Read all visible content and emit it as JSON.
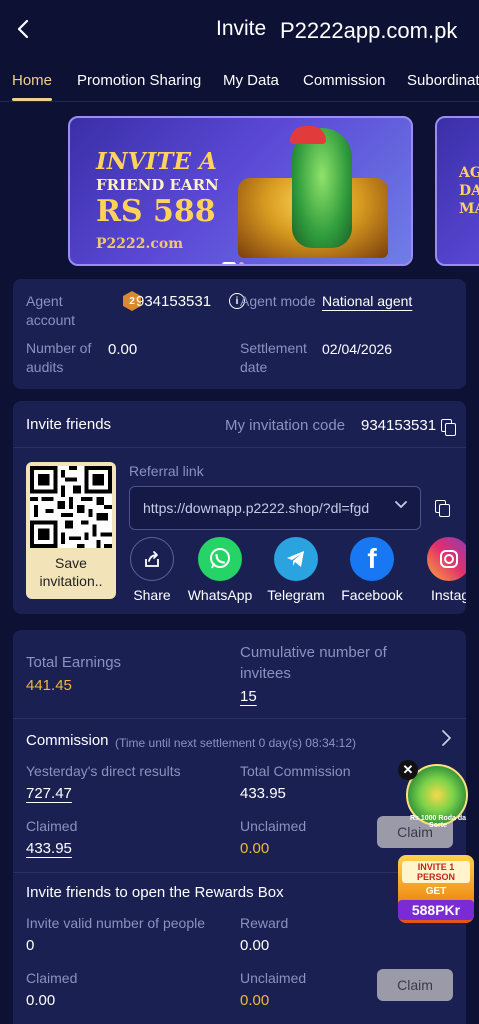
{
  "header": {
    "title": "Invite",
    "domain": "P2222app.com.pk"
  },
  "tabs": [
    {
      "label": "Home",
      "active": true
    },
    {
      "label": "Promotion Sharing",
      "active": false
    },
    {
      "label": "My Data",
      "active": false
    },
    {
      "label": "Commission",
      "active": false
    },
    {
      "label": "Subordinat",
      "active": false
    }
  ],
  "banner": {
    "line1": "INVITE A",
    "line2": "FRIEND EARN",
    "line3": "RS 588",
    "logo": "P2222.com",
    "next_text": "AG DAI MA"
  },
  "agent": {
    "account_label": "Agent account",
    "level": "2",
    "account_value": "934153531",
    "mode_label": "Agent mode",
    "mode_value": "National agent",
    "audits_label": "Number of audits",
    "audits_value": "0.00",
    "settlement_label": "Settlement date",
    "settlement_value": "02/04/2026"
  },
  "invite": {
    "title": "Invite friends",
    "code_label": "My invitation code",
    "code_value": "934153531",
    "save_label": "Save invitation..",
    "referral_label": "Referral link",
    "referral_url": "https://downapp.p2222.shop/?dl=fgd",
    "share_items": [
      {
        "label": "Share",
        "icon": "share-icon"
      },
      {
        "label": "WhatsApp",
        "icon": "whatsapp-icon"
      },
      {
        "label": "Telegram",
        "icon": "telegram-icon"
      },
      {
        "label": "Facebook",
        "icon": "facebook-icon"
      },
      {
        "label": "Instag",
        "icon": "instagram-icon"
      }
    ]
  },
  "earnings": {
    "total_label": "Total Earnings",
    "total_value": "441.45",
    "cumulative_label": "Cumulative number of invitees",
    "cumulative_value": "15"
  },
  "commission": {
    "title": "Commission",
    "timer_text": "(Time until next settlement  0 day(s) 08:34:12)",
    "yesterday_label": "Yesterday's direct results",
    "yesterday_value": "727.47",
    "total_label": "Total Commission",
    "total_value": "433.95",
    "claimed_label": "Claimed",
    "claimed_value": "433.95",
    "unclaimed_label": "Unclaimed",
    "unclaimed_value": "0.00",
    "claim_label": "Claim"
  },
  "rewards": {
    "title": "Invite friends to open the Rewards Box",
    "valid_label": "Invite valid number of people",
    "valid_value": "0",
    "reward_label": "Reward",
    "reward_value": "0.00",
    "claimed_label": "Claimed",
    "claimed_value": "0.00",
    "unclaimed_label": "Unclaimed",
    "unclaimed_value": "0.00",
    "claim_label": "Claim"
  },
  "floating": {
    "wheel_text": "Rs 1000 Roda da Sorte",
    "invite_top": "INVITE 1 PERSON",
    "invite_get": "GET",
    "invite_amount": "588PKr"
  },
  "colors": {
    "background": "#0d1235",
    "card": "#1a2052",
    "accent_gold": "#f0b93a",
    "tab_active": "#f0d08a"
  }
}
